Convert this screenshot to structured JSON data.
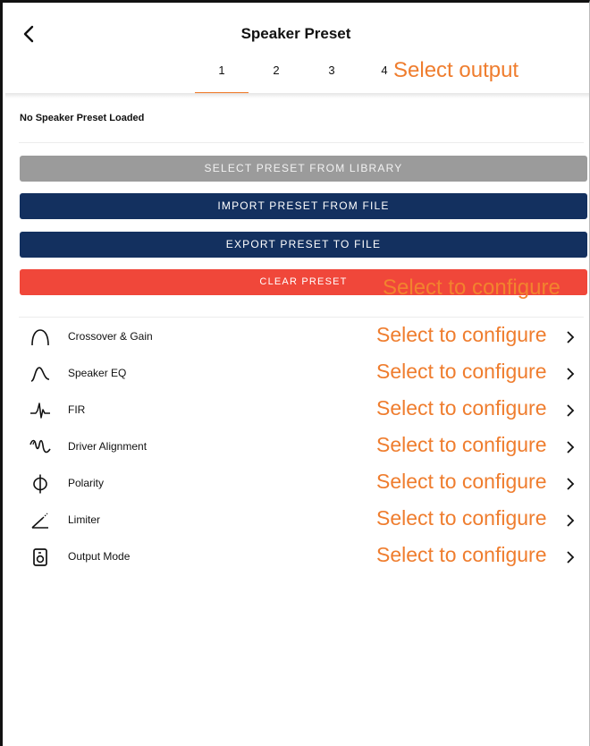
{
  "header": {
    "title": "Speaker Preset",
    "back_icon": "chevron-left-icon"
  },
  "tabs": [
    {
      "label": "1",
      "active": true
    },
    {
      "label": "2",
      "active": false
    },
    {
      "label": "3",
      "active": false
    },
    {
      "label": "4",
      "active": false
    }
  ],
  "tab_annotation": "Select output",
  "status": "No Speaker Preset Loaded",
  "buttons": {
    "select_library": "SELECT PRESET FROM LIBRARY",
    "import_file": "IMPORT PRESET FROM FILE",
    "export_file": "EXPORT PRESET TO FILE",
    "clear": "CLEAR PRESET",
    "clear_annotation": "Select to configure"
  },
  "menu": [
    {
      "label": "Crossover & Gain",
      "icon": "crossover-arch-icon",
      "hint": "Select to configure"
    },
    {
      "label": "Speaker EQ",
      "icon": "eq-curve-icon",
      "hint": "Select to configure"
    },
    {
      "label": "FIR",
      "icon": "fir-impulse-icon",
      "hint": "Select to configure"
    },
    {
      "label": "Driver Alignment",
      "icon": "driver-alignment-wave-icon",
      "hint": "Select to configure"
    },
    {
      "label": "Polarity",
      "icon": "polarity-phi-icon",
      "hint": "Select to configure"
    },
    {
      "label": "Limiter",
      "icon": "limiter-slope-icon",
      "hint": "Select to configure"
    },
    {
      "label": "Output Mode",
      "icon": "speaker-icon",
      "hint": "Select to configure"
    }
  ],
  "colors": {
    "accent_orange": "#ef7d2e",
    "navy": "#13305f",
    "gray_button": "#9b9b9b",
    "red_button": "#f0473a"
  }
}
